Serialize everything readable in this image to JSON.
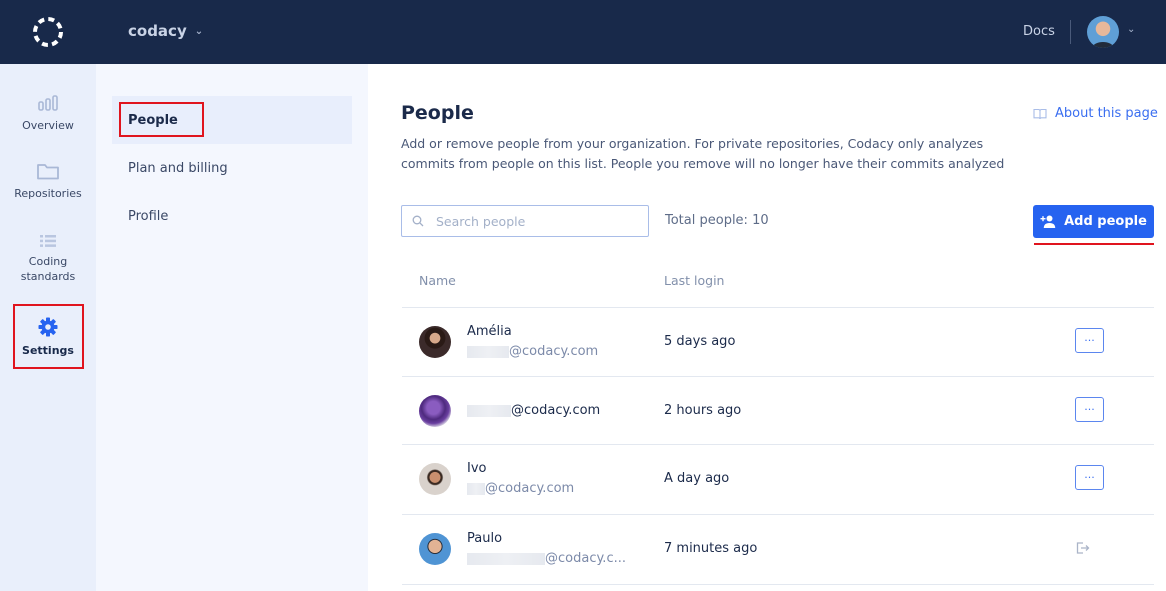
{
  "topbar": {
    "org_name": "codacy",
    "docs_label": "Docs",
    "logo_icon": "codacy-logo-icon",
    "chevron_icon": "chevron-down-icon"
  },
  "leftnav": {
    "items": [
      {
        "label": "Overview",
        "icon": "bar-chart-icon",
        "active": false
      },
      {
        "label": "Repositories",
        "icon": "folder-icon",
        "active": false
      },
      {
        "label": "Coding standards",
        "icon": "list-icon",
        "active": false
      },
      {
        "label": "Settings",
        "icon": "gear-icon",
        "active": true
      }
    ]
  },
  "subnav": {
    "items": [
      {
        "label": "People",
        "active": true
      },
      {
        "label": "Plan and billing",
        "active": false
      },
      {
        "label": "Profile",
        "active": false
      }
    ]
  },
  "main": {
    "title": "People",
    "about_label": "About this page",
    "description": "Add or remove people from your organization. For private repositories, Codacy only analyzes commits from people on this list. People you remove will no longer have their commits analyzed",
    "search_placeholder": "Search people",
    "search_value": "",
    "total_label": "Total people: 10",
    "add_button_label": "Add people",
    "columns": [
      "Name",
      "Last login"
    ],
    "rows": [
      {
        "name": "Amélia",
        "email_domain": "@codacy.com",
        "last_login": "5 days ago",
        "action": "more"
      },
      {
        "name": "",
        "email_domain": "@codacy.com",
        "last_login": "2 hours ago",
        "action": "more"
      },
      {
        "name": "Ivo",
        "email_domain": "@codacy.com",
        "last_login": "A day ago",
        "action": "more"
      },
      {
        "name": "Paulo",
        "email_domain": "@codacy.c...",
        "last_login": "7 minutes ago",
        "action": "leave"
      }
    ],
    "more_label": "..."
  },
  "colors": {
    "topbar_bg": "#18294a",
    "accent": "#2663f0",
    "highlight": "#e0141e"
  }
}
